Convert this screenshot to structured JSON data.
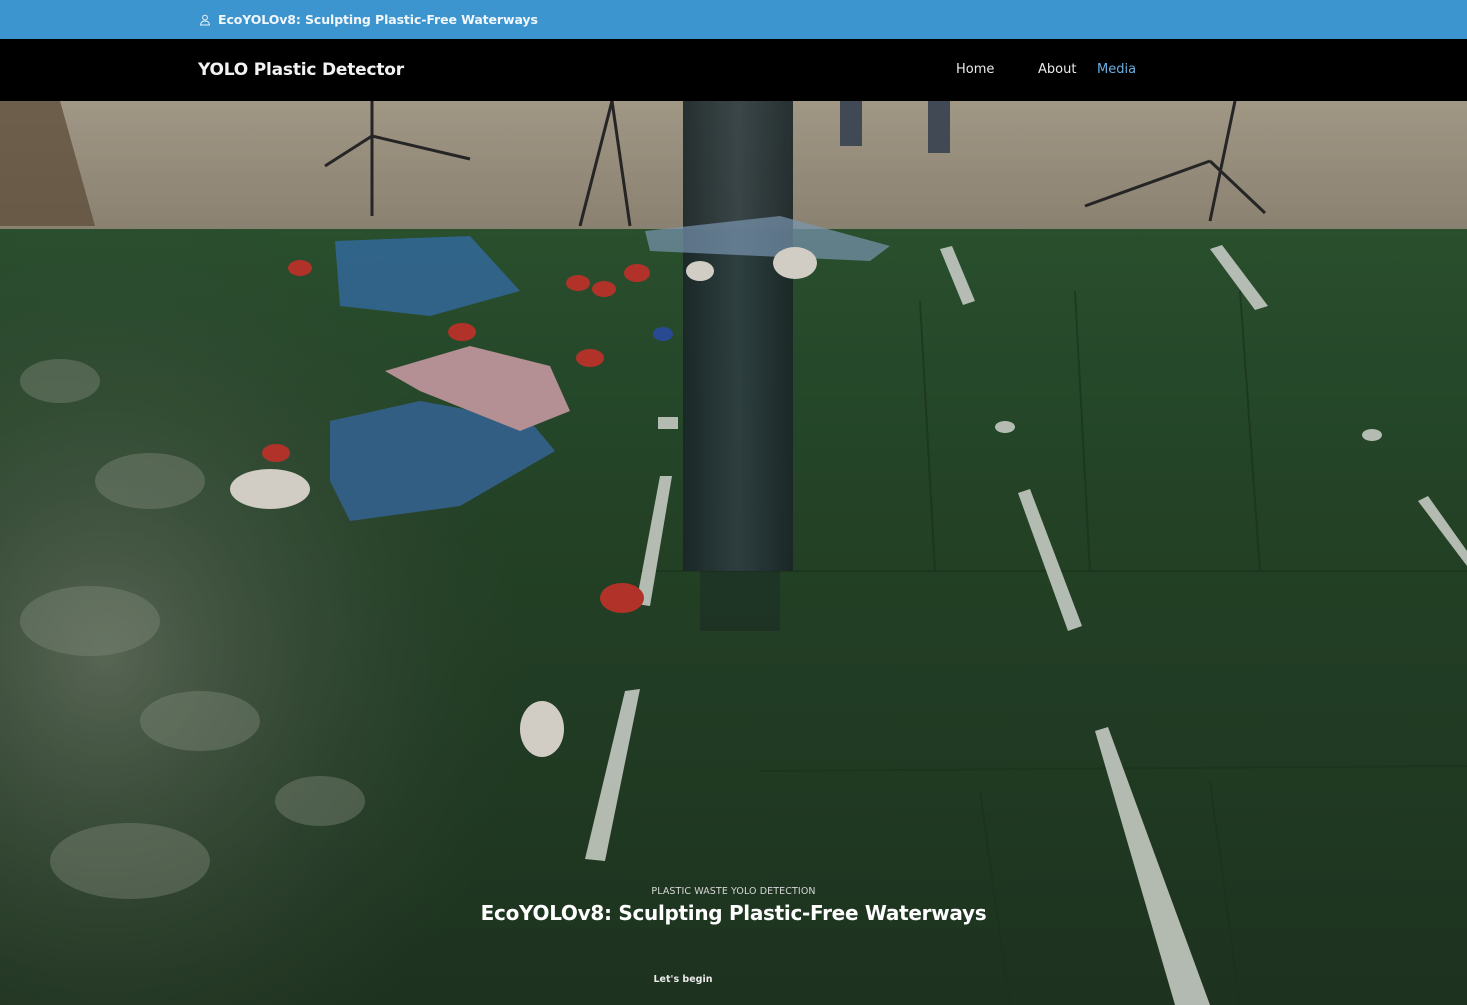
{
  "topbar": {
    "icon": "user-icon",
    "tagline": "EcoYOLOv8: Sculpting Plastic-Free Waterways"
  },
  "navbar": {
    "brand": "YOLO Plastic Detector",
    "links": [
      {
        "label": "Home",
        "active": false
      },
      {
        "label": "About",
        "active": false
      },
      {
        "label": "Media",
        "active": true
      }
    ]
  },
  "hero": {
    "eyebrow": "PLASTIC WASTE YOLO DETECTION",
    "title": "EcoYOLOv8: Sculpting Plastic-Free Waterways",
    "cta_label": "Let's begin"
  },
  "colors": {
    "topbar_bg": "#3d95d0",
    "navbar_bg": "#000000",
    "nav_active": "#6aaee0",
    "water_green": "#2c4a2c"
  }
}
